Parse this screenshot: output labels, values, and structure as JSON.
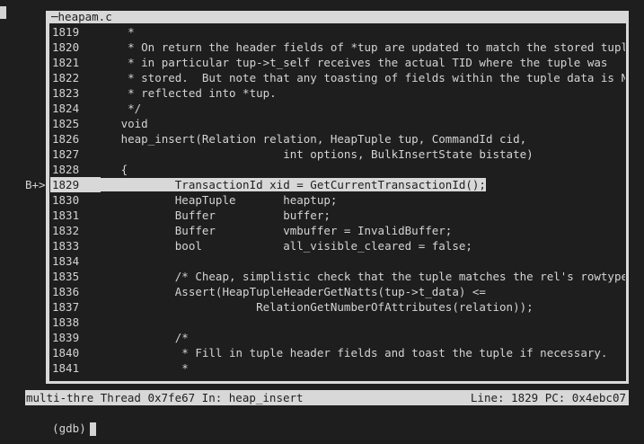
{
  "source_window": {
    "title": "heapam.c",
    "lines": [
      {
        "num": "1819",
        "code": "    *"
      },
      {
        "num": "1820",
        "code": "    * On return the header fields of *tup are updated to match the stored tuple;"
      },
      {
        "num": "1821",
        "code": "    * in particular tup->t_self receives the actual TID where the tuple was"
      },
      {
        "num": "1822",
        "code": "    * stored.  But note that any toasting of fields within the tuple data is NOT"
      },
      {
        "num": "1823",
        "code": "    * reflected into *tup."
      },
      {
        "num": "1824",
        "code": "    */"
      },
      {
        "num": "1825",
        "code": "   void"
      },
      {
        "num": "1826",
        "code": "   heap_insert(Relation relation, HeapTuple tup, CommandId cid,"
      },
      {
        "num": "1827",
        "code": "                           int options, BulkInsertState bistate)"
      },
      {
        "num": "1828",
        "code": "   {"
      },
      {
        "num": "1829",
        "code": "           TransactionId xid = GetCurrentTransactionId();"
      },
      {
        "num": "1830",
        "code": "           HeapTuple       heaptup;"
      },
      {
        "num": "1831",
        "code": "           Buffer          buffer;"
      },
      {
        "num": "1832",
        "code": "           Buffer          vmbuffer = InvalidBuffer;"
      },
      {
        "num": "1833",
        "code": "           bool            all_visible_cleared = false;"
      },
      {
        "num": "1834",
        "code": ""
      },
      {
        "num": "1835",
        "code": "           /* Cheap, simplistic check that the tuple matches the rel's rowtype. */"
      },
      {
        "num": "1836",
        "code": "           Assert(HeapTupleHeaderGetNatts(tup->t_data) <="
      },
      {
        "num": "1837",
        "code": "                       RelationGetNumberOfAttributes(relation));"
      },
      {
        "num": "1838",
        "code": ""
      },
      {
        "num": "1839",
        "code": "           /*"
      },
      {
        "num": "1840",
        "code": "            * Fill in tuple header fields and toast the tuple if necessary."
      },
      {
        "num": "1841",
        "code": "            *"
      }
    ],
    "current_line": "1829",
    "breakpoint_marker": "B+>"
  },
  "status_bar": {
    "left": "multi-thre Thread 0x7fe67 In: heap_insert",
    "right": "Line: 1829 PC: 0x4ebc07"
  },
  "prompt": {
    "text": "(gdb)"
  },
  "colors": {
    "background": "#1e1e1e",
    "foreground": "#d4d4d4",
    "frame": "#d8d8d8"
  }
}
